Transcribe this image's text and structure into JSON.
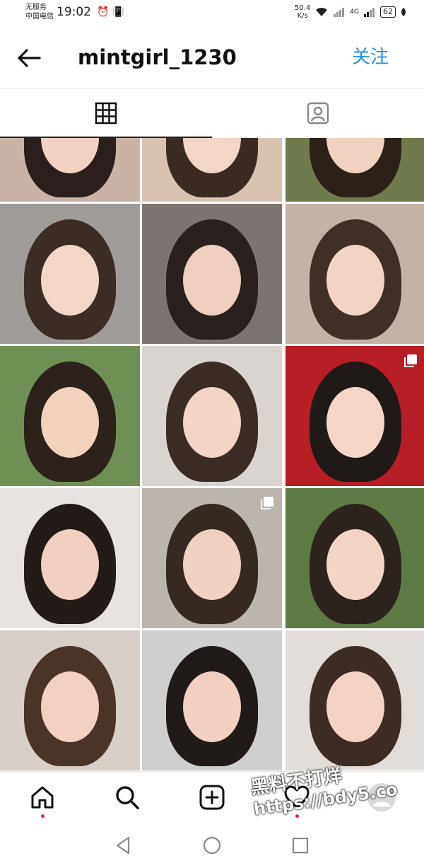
{
  "status_bar": {
    "carrier_line1": "无服务",
    "carrier_line2": "中国电信",
    "time": "19:02",
    "left_icons": "⏰ 📳",
    "net_speed_value": "50.4",
    "net_speed_unit": "K/s",
    "network_label": "4G",
    "battery": "62"
  },
  "header": {
    "username": "mintgirl_1230",
    "follow_label": "关注"
  },
  "tabs": [
    {
      "name": "grid-icon",
      "active": true
    },
    {
      "name": "tagged-person-icon",
      "active": false
    }
  ],
  "posts": [
    {
      "bg": "#c9b3a7",
      "skin": "#f0d3c4",
      "hair": "#2a1f1c",
      "multi": false
    },
    {
      "bg": "#d8c2b2",
      "skin": "#f3d7c6",
      "hair": "#3a2a22",
      "multi": false
    },
    {
      "bg": "#6f7a4d",
      "skin": "#efd2bf",
      "hair": "#2b2119",
      "multi": false
    },
    {
      "bg": "#9f9c9a",
      "skin": "#f2d6c8",
      "hair": "#3b2d26",
      "multi": false
    },
    {
      "bg": "#7b7470",
      "skin": "#efd0c0",
      "hair": "#2a211e",
      "multi": false
    },
    {
      "bg": "#c3b3a6",
      "skin": "#f1d4c3",
      "hair": "#3f2f27",
      "multi": false
    },
    {
      "bg": "#6f8f55",
      "skin": "#f0d2bf",
      "hair": "#2c211b",
      "multi": false
    },
    {
      "bg": "#d9d4d0",
      "skin": "#f2d5c6",
      "hair": "#3a2c25",
      "multi": false
    },
    {
      "bg": "#b81e26",
      "skin": "#f3d6c7",
      "hair": "#1f1a18",
      "multi": true
    },
    {
      "bg": "#e7e3e0",
      "skin": "#f0d0c2",
      "hair": "#231b18",
      "multi": false
    },
    {
      "bg": "#bcb5ae",
      "skin": "#efd1c1",
      "hair": "#352922",
      "multi": true
    },
    {
      "bg": "#5d7a45",
      "skin": "#f2d5c7",
      "hair": "#2d231e",
      "multi": false
    },
    {
      "bg": "#d8cfc9",
      "skin": "#f1d2c2",
      "hair": "#4a3428",
      "multi": false
    },
    {
      "bg": "#cfcfcf",
      "skin": "#f0d0c1",
      "hair": "#201a18",
      "multi": false
    },
    {
      "bg": "#e2ddd8",
      "skin": "#f3d3c6",
      "hair": "#3c2c24",
      "multi": false
    }
  ],
  "bottom_nav": [
    {
      "name": "home-icon",
      "dot": true
    },
    {
      "name": "search-icon",
      "dot": false
    },
    {
      "name": "new-post-icon",
      "dot": false
    },
    {
      "name": "activity-heart-icon",
      "dot": true
    },
    {
      "name": "profile-avatar-icon",
      "dot": false
    }
  ],
  "watermark": {
    "line1": "黑料不打烊",
    "line2": "https://bdy5.co"
  },
  "colors": {
    "accent_blue": "#2193ea",
    "notification_dot": "#e0245e"
  }
}
